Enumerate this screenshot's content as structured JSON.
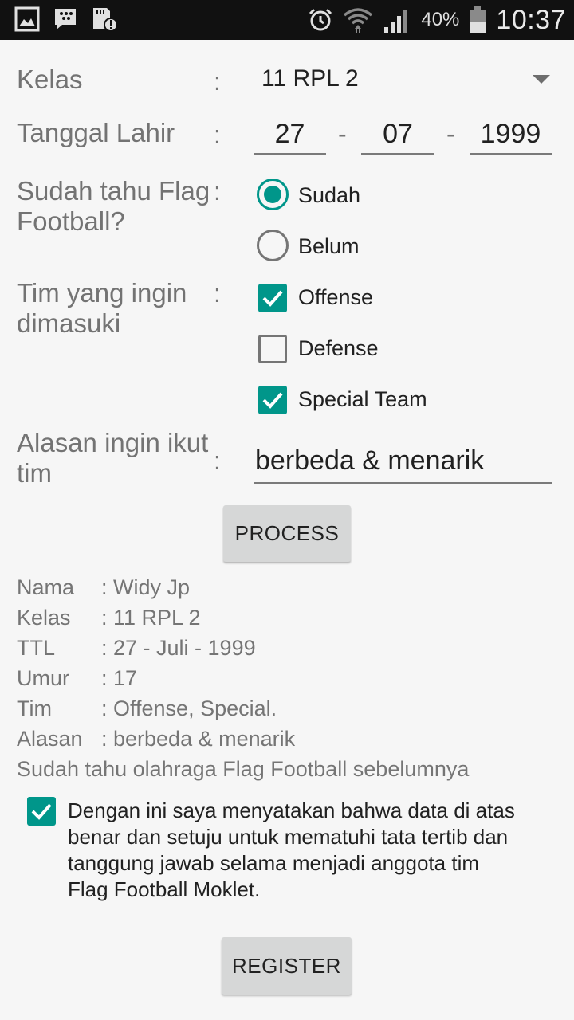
{
  "status_bar": {
    "icons_left": [
      "gallery-icon",
      "bbm-icon",
      "sd-card-alert-icon"
    ],
    "icons_right": [
      "alarm-icon",
      "wifi-icon",
      "signal-icon",
      "battery-icon"
    ],
    "battery": "40%",
    "time": "10:37"
  },
  "form": {
    "colon": ":",
    "kelas": {
      "label": "Kelas",
      "value": "11 RPL 2"
    },
    "tanggal_lahir": {
      "label": "Tanggal Lahir",
      "day": "27",
      "month": "07",
      "year": "1999",
      "separator": "-"
    },
    "flag_football": {
      "label_line1": "Sudah tahu Flag",
      "label_line2": "Football?",
      "options": [
        {
          "label": "Sudah",
          "checked": true
        },
        {
          "label": "Belum",
          "checked": false
        }
      ]
    },
    "tim": {
      "label_line1": "Tim yang ingin",
      "label_line2": "dimasuki",
      "options": [
        {
          "label": "Offense",
          "checked": true
        },
        {
          "label": "Defense",
          "checked": false
        },
        {
          "label": "Special Team",
          "checked": true
        }
      ]
    },
    "alasan": {
      "label_line1": "Alasan ingin ikut",
      "label_line2": "tim",
      "value": "berbeda & menarik"
    },
    "process_button": "PROCESS"
  },
  "result": {
    "rows": [
      {
        "key": "Nama",
        "value": ": Widy Jp"
      },
      {
        "key": "Kelas",
        "value": ": 11 RPL 2"
      },
      {
        "key": "TTL",
        "value": ": 27 - Juli - 1999"
      },
      {
        "key": "Umur",
        "value": ": 17"
      },
      {
        "key": "Tim",
        "value": ": Offense, Special."
      },
      {
        "key": "Alasan",
        "value": ": berbeda & menarik"
      }
    ],
    "note": "Sudah tahu olahraga Flag Football sebelumnya"
  },
  "agreement": {
    "checked": true,
    "line1": "Dengan ini saya menyatakan bahwa data di atas",
    "line2": "benar dan setuju untuk mematuhi tata tertib dan",
    "line3": "tanggung jawab selama menjadi anggota tim",
    "line4": "Flag Football Moklet."
  },
  "register_button": "REGISTER",
  "colors": {
    "accent": "#00968a",
    "status_bar": "#111111",
    "background": "#f6f6f6",
    "button": "#d6d7d7"
  }
}
